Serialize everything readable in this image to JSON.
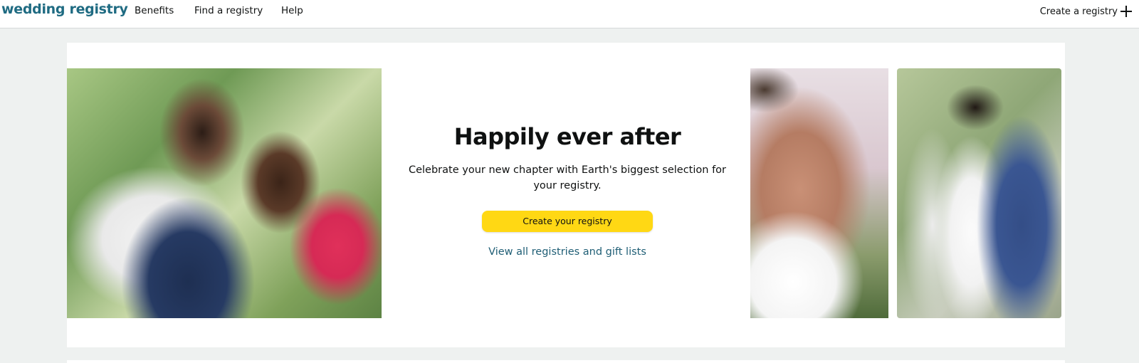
{
  "header": {
    "brand": "wedding registry",
    "nav": {
      "benefits": "Benefits",
      "find": "Find a registry",
      "help": "Help"
    },
    "create_label": "Create a registry",
    "create_icon": "plus-icon"
  },
  "hero": {
    "headline": "Happily ever after",
    "subtext": "Celebrate your new chapter with Earth's biggest selection for your registry.",
    "cta_label": "Create your registry",
    "view_link": "View all registries and gift lists",
    "cta_color": "#ffd814",
    "link_color": "#1f5e75",
    "brand_color": "#1f6b82"
  }
}
